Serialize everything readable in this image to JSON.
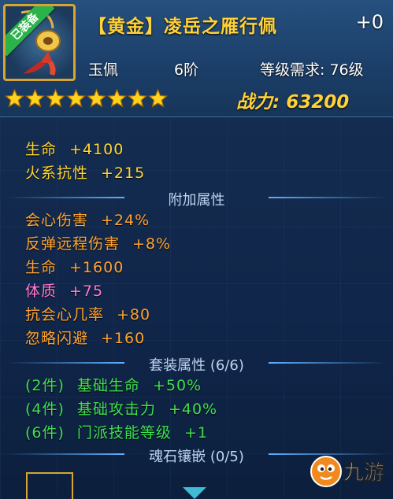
{
  "item": {
    "title": "【黄金】凌岳之雁行佩",
    "enhance": "+0",
    "equipped_badge": "已装备",
    "type": "玉佩",
    "rank": "6阶",
    "level_req": "等级需求: 76级",
    "stars": 8,
    "power_label": "战力:",
    "power_value": "63200"
  },
  "base_stats": [
    {
      "name": "生命",
      "value": "+4100"
    },
    {
      "name": "火系抗性",
      "value": "+215"
    }
  ],
  "sections": {
    "bonus": "附加属性",
    "set": "套装属性 (6/6)",
    "soul": "魂石镶嵌 (0/5)"
  },
  "bonus_stats": [
    {
      "name": "会心伤害",
      "value": "+24%"
    },
    {
      "name": "反弹远程伤害",
      "value": "+8%"
    },
    {
      "name": "生命",
      "value": "+1600"
    },
    {
      "name": "体质",
      "value": "+75"
    },
    {
      "name": "抗会心几率",
      "value": "+80"
    },
    {
      "name": "忽略闪避",
      "value": "+160"
    }
  ],
  "set_stats": [
    {
      "pieces": "(2件)",
      "name": "基础生命",
      "value": "+50%"
    },
    {
      "pieces": "(4件)",
      "name": "基础攻击力",
      "value": "+40%"
    },
    {
      "pieces": "(6件)",
      "name": "门派技能等级",
      "value": "+1"
    }
  ],
  "watermark": "九游",
  "colors": {
    "gold_text": "#ffd23a",
    "base_stat": "#ffd631",
    "bonus_stat": "#ffa431",
    "highlight_stat": "#ff7ad6",
    "set_stat": "#3fe04f",
    "frame": "#d8a630"
  }
}
